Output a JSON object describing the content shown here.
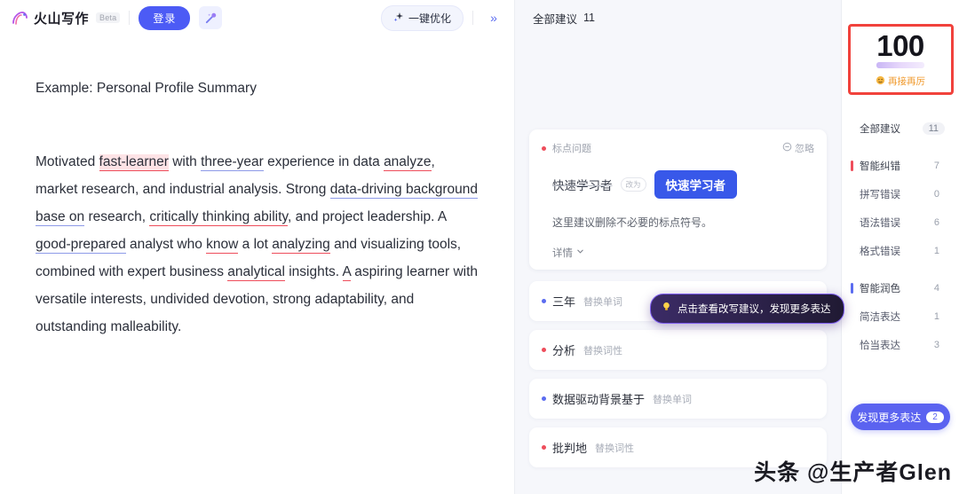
{
  "editor": {
    "brand_name": "火山写作",
    "beta_label": "Beta",
    "login_label": "登录",
    "magic_icon": "magic-wand-icon",
    "optimize_label": "一键优化",
    "sparkle_icon": "sparkle-icon",
    "collapse_icon": "double-chevron-right-icon",
    "doc_title": "Example: Personal Profile Summary",
    "paragraph": {
      "seg1": "Motivated ",
      "err1": "fast-learner",
      "seg2": " with ",
      "blue1": "three-year",
      "seg3": " experience in data ",
      "err2": "analyze",
      "seg4": ", market research, and industrial analysis. Strong ",
      "blue2": "data-driving background base on",
      "seg5": " research, ",
      "err3": "critically thinking ability",
      "seg6": ", and project leadership. A ",
      "blue3": "good-prepared",
      "seg7": " analyst who ",
      "err4": "know",
      "seg8": " a lot ",
      "err5": "analyzing",
      "seg9": " and visualizing tools, combined with expert business ",
      "err6": "analytical",
      "seg10": " insights. ",
      "err7": "A",
      "seg11": " aspiring learner with versatile interests, undivided devotion, strong adaptability, and outstanding malleability."
    }
  },
  "suggestions": {
    "header_title": "全部建议",
    "header_count": "11",
    "card": {
      "tag": "标点问题",
      "dot": "red",
      "ignore_label": "忽略",
      "ignore_icon": "ignore-circle-icon",
      "original_text": "快速学习者",
      "arrow_label": "改为",
      "suggested_text": "快速学习者",
      "description": "这里建议删除不必要的标点符号。",
      "detail_label": "详情",
      "detail_icon": "chevron-down-icon"
    },
    "rows": [
      {
        "text": "三年",
        "action": "替换单词",
        "dot": "blue"
      },
      {
        "text": "分析",
        "action": "替换词性",
        "dot": "red"
      },
      {
        "text": "数据驱动背景基于",
        "action": "替换单词",
        "dot": "blue"
      },
      {
        "text": "批判地",
        "action": "替换词性",
        "dot": "red"
      }
    ],
    "tooltip": {
      "icon": "lightbulb-icon",
      "text": "点击查看改写建议，发现更多表达"
    }
  },
  "score_panel": {
    "score": "100",
    "caption_icon": "smiley-icon",
    "caption": "再接再厉",
    "categories": [
      {
        "label": "全部建议",
        "count": "11",
        "marker": "none",
        "style": "pill"
      },
      {
        "label": "智能纠错",
        "count": "7",
        "marker": "red",
        "style": "plain"
      },
      {
        "label": "拼写错误",
        "count": "0",
        "marker": "none",
        "style": "plain"
      },
      {
        "label": "语法错误",
        "count": "6",
        "marker": "none",
        "style": "plain"
      },
      {
        "label": "格式错误",
        "count": "1",
        "marker": "none",
        "style": "plain"
      },
      {
        "label": "智能润色",
        "count": "4",
        "marker": "blue",
        "style": "plain"
      },
      {
        "label": "简洁表达",
        "count": "1",
        "marker": "none",
        "style": "plain"
      },
      {
        "label": "恰当表达",
        "count": "3",
        "marker": "none",
        "style": "plain"
      }
    ],
    "more_button_label": "发现更多表达",
    "more_button_badge": "2"
  },
  "watermark": "头条 @生产者Glen",
  "colors": {
    "primary": "#4c5bf5",
    "suggest_blue": "#3858e9",
    "error_red": "#ee4d5b",
    "highlight_box": "#f1423c",
    "caption_orange": "#f09a2e"
  }
}
